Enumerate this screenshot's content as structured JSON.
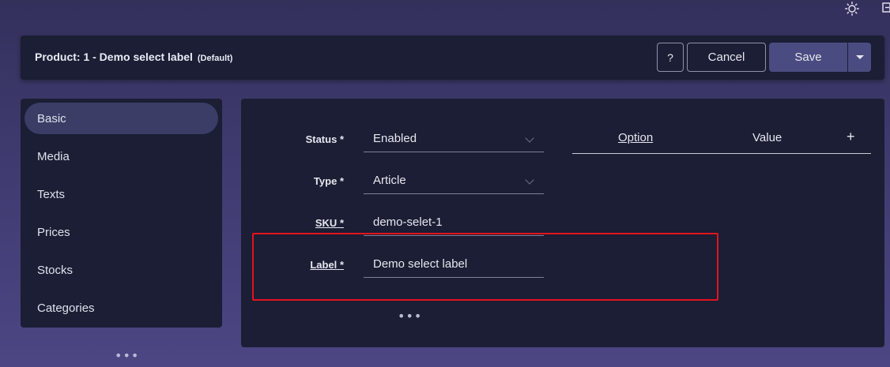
{
  "top_icons": {
    "theme": "sun-icon",
    "exit": "exit-icon"
  },
  "header": {
    "title": "Product: 1 - Demo select label",
    "subtitle": "(Default)",
    "help_label": "?",
    "cancel_label": "Cancel",
    "save_label": "Save"
  },
  "sidebar": {
    "items": [
      {
        "label": "Basic",
        "active": true
      },
      {
        "label": "Media"
      },
      {
        "label": "Texts"
      },
      {
        "label": "Prices"
      },
      {
        "label": "Stocks"
      },
      {
        "label": "Categories"
      }
    ],
    "more": "•••"
  },
  "form": {
    "status": {
      "label": "Status",
      "required": "*",
      "value": "Enabled"
    },
    "type": {
      "label": "Type",
      "required": "*",
      "value": "Article"
    },
    "sku": {
      "label": "SKU",
      "required": "*",
      "value": "demo-selet-1"
    },
    "label": {
      "label": "Label",
      "required": "*",
      "value": "Demo select label"
    },
    "more": "•••"
  },
  "options_table": {
    "columns": [
      "Option",
      "Value"
    ],
    "add": "+"
  },
  "colors": {
    "highlight": "#e5121e",
    "accent": "#4a4b80"
  }
}
